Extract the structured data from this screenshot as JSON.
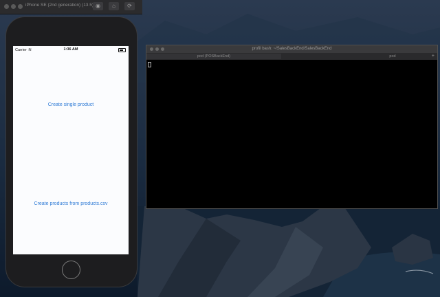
{
  "simulator": {
    "title": "iPhone SE (2nd generation) (13.5)",
    "toolbar_icons": [
      "screenshot-icon",
      "home-icon",
      "rotate-icon"
    ]
  },
  "phone": {
    "status_bar": {
      "carrier": "Carrier",
      "time": "1:36 AM"
    },
    "buttons": {
      "create_single": "Create single product",
      "create_from_csv": "Create products from products.csv"
    }
  },
  "terminal": {
    "title": "profil bash: ~/SalesBackEnd/SalesBackEnd",
    "tabs": [
      "pod (POSBackEnd)",
      "",
      "pod"
    ],
    "add_tab": "+"
  },
  "colors": {
    "link": "#2f7bd6",
    "terminal_bg": "#000000",
    "desktop": "#1b2a3e"
  }
}
